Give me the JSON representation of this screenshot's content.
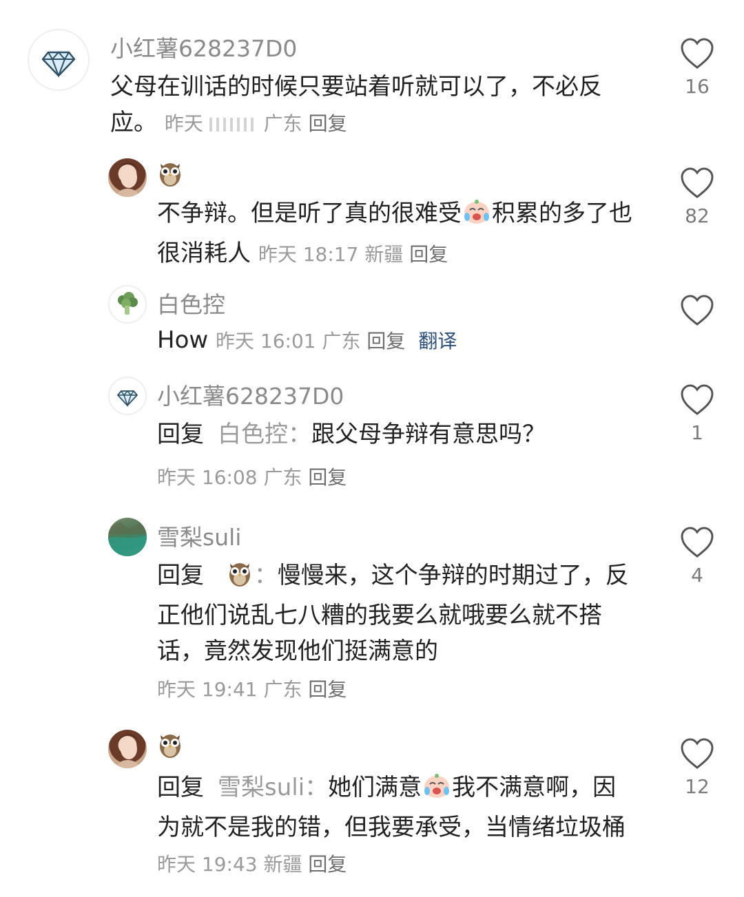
{
  "comments": [
    {
      "user": "小红薯628237D0",
      "text": "父母在训话的时候只要站着听就可以了，不必反应。",
      "time": "昨天",
      "location": "广东",
      "reply": "回复",
      "likes": "16",
      "avatar_icon": "diamond-icon"
    },
    {
      "user_icon": "owl-icon",
      "text": "不争辩。但是听了真的很难受",
      "text_after_emoji": "积累的多了也很消耗人",
      "emoji_icon": "crying-face-icon",
      "time": "昨天 18:17",
      "location": "新疆",
      "reply": "回复",
      "likes": "82"
    },
    {
      "user": "白色控",
      "text": "How",
      "time": "昨天 16:01",
      "location": "广东",
      "reply": "回复",
      "translate": "翻译",
      "likes": "",
      "avatar_icon": "broccoli-icon"
    },
    {
      "user": "小红薯628237D0",
      "reply_prefix": "回复",
      "reply_target": "白色控：",
      "text": "跟父母争辩有意思吗？",
      "time": "昨天 16:08",
      "location": "广东",
      "reply": "回复",
      "likes": "1",
      "avatar_icon": "diamond-icon"
    },
    {
      "user": "雪梨suli",
      "reply_prefix": "回复",
      "reply_target_icon": "owl-icon",
      "reply_colon": "：",
      "text": "慢慢来，这个争辩的时期过了，反正他们说乱七八糟的我要么就哦要么就不搭话，竟然发现他们挺满意的",
      "time": "昨天 19:41",
      "location": "广东",
      "reply": "回复",
      "likes": "4"
    },
    {
      "user_icon": "owl-icon",
      "reply_prefix": "回复",
      "reply_target": "雪梨suli：",
      "text": "她们满意",
      "text_after_emoji": "我不满意啊，因为就不是我的错，但我要承受，当情绪垃圾桶",
      "emoji_icon": "crying-face-icon",
      "time": "昨天 19:43",
      "location": "新疆",
      "reply": "回复",
      "likes": "12"
    }
  ],
  "colors": {
    "text": "#222222",
    "muted": "#9a9a9a",
    "translate": "#2d4f7a",
    "heart_outline": "#555555"
  }
}
